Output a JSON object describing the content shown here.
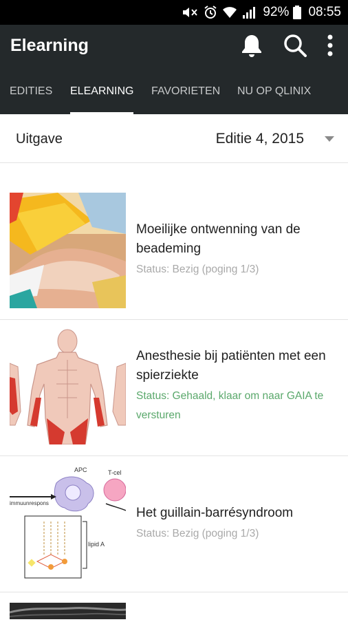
{
  "statusbar": {
    "battery": "92%",
    "time": "08:55"
  },
  "appbar": {
    "title": "Elearning",
    "icons": [
      "bell-icon",
      "search-icon",
      "more-vert-icon"
    ]
  },
  "tabs": [
    {
      "label": "EDITIES",
      "active": false
    },
    {
      "label": "ELEARNING",
      "active": true
    },
    {
      "label": "FAVORIETEN",
      "active": false
    },
    {
      "label": "NU OP QLINIX",
      "active": false
    }
  ],
  "filter": {
    "label": "Uitgave",
    "value": "Editie 4, 2015"
  },
  "items": [
    {
      "title": "Moeilijke ontwenning van de beademing",
      "status": "Status: Bezig (poging 1/3)"
    },
    {
      "title": "Anesthesie bij patiënten met een spierziekte",
      "status": "Status: Gehaald, klaar om naar GAIA te versturen"
    },
    {
      "title": "Het guillain-barrésyndroom",
      "status": "Status: Bezig (poging 1/3)",
      "thumb_labels": {
        "apc": "APC",
        "tcell": "T-cel",
        "immune": "immuunrespons",
        "lipid": "lipid A"
      }
    }
  ],
  "colors": {
    "appbar": "#24292b",
    "status_done": "#5aa86b",
    "status_busy": "#a9a9a9"
  }
}
